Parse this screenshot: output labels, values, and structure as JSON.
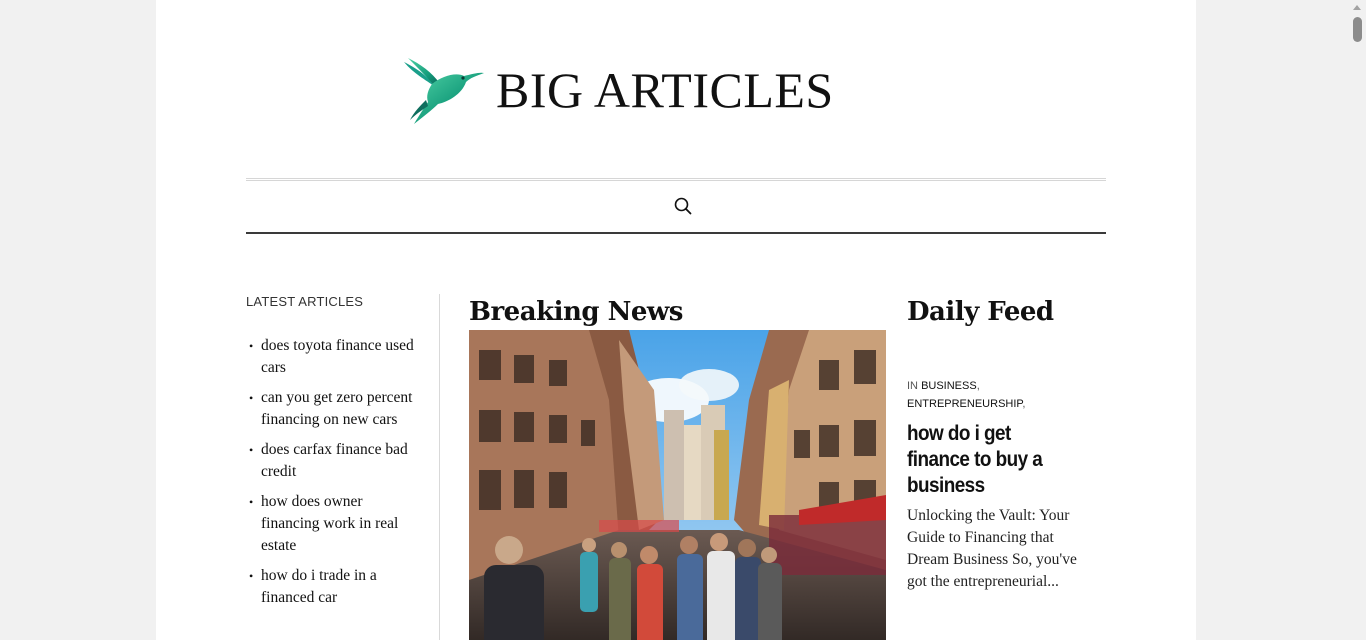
{
  "site": {
    "logo_text": "BIG ARTICLES"
  },
  "nav": {
    "search_icon": "search-icon"
  },
  "sidebar": {
    "title": "LATEST ARTICLES",
    "items": [
      {
        "label": "does toyota finance used cars"
      },
      {
        "label": "can you get zero percent financing on new cars"
      },
      {
        "label": "does carfax finance bad credit"
      },
      {
        "label": "how does owner financing work in real estate"
      },
      {
        "label": "how do i trade in a financed car"
      }
    ]
  },
  "breaking": {
    "heading": "Breaking News"
  },
  "daily": {
    "heading": "Daily Feed",
    "meta_prefix": "IN",
    "categories": [
      "BUSINESS",
      "ENTREPRENEURSHIP"
    ],
    "post_title": "how do i get finance to buy a business",
    "excerpt": "Unlocking the Vault: Your Guide to Financing that Dream Business So, you've got the entrepreneurial..."
  }
}
